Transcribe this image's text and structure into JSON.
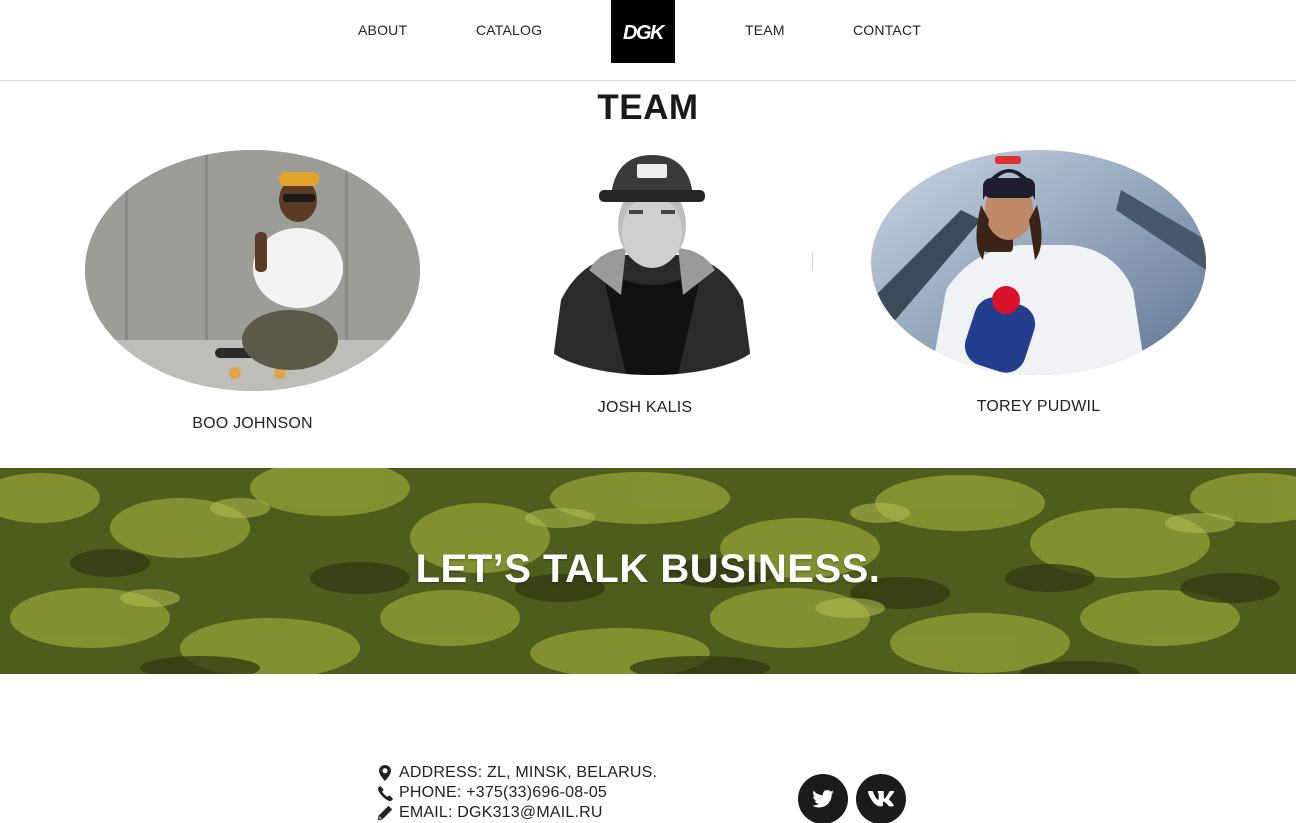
{
  "nav": {
    "items": [
      {
        "label": "ABOUT"
      },
      {
        "label": "CATALOG"
      },
      {
        "label": "TEAM"
      },
      {
        "label": "CONTACT"
      }
    ],
    "logo_text": "DGK"
  },
  "team": {
    "title": "TEAM",
    "members": [
      {
        "name": "BOO JOHNSON"
      },
      {
        "name": "JOSH KALIS"
      },
      {
        "name": "TOREY PUDWIL"
      }
    ]
  },
  "banner": {
    "title": "LET’S TALK BUSINESS."
  },
  "contact": {
    "address": "ADDRESS: ZL, MINSK, BELARUS.",
    "phone": "PHONE: +375(33)696-08-05",
    "email": "EMAIL: DGK313@MAIL.RU"
  },
  "social": [
    {
      "icon": "twitter-icon"
    },
    {
      "icon": "vk-icon"
    }
  ],
  "colors": {
    "text": "#222222",
    "logo_bg": "#000000",
    "social_bg": "#1b1b1b",
    "banner_green": "#5b6a1e"
  }
}
